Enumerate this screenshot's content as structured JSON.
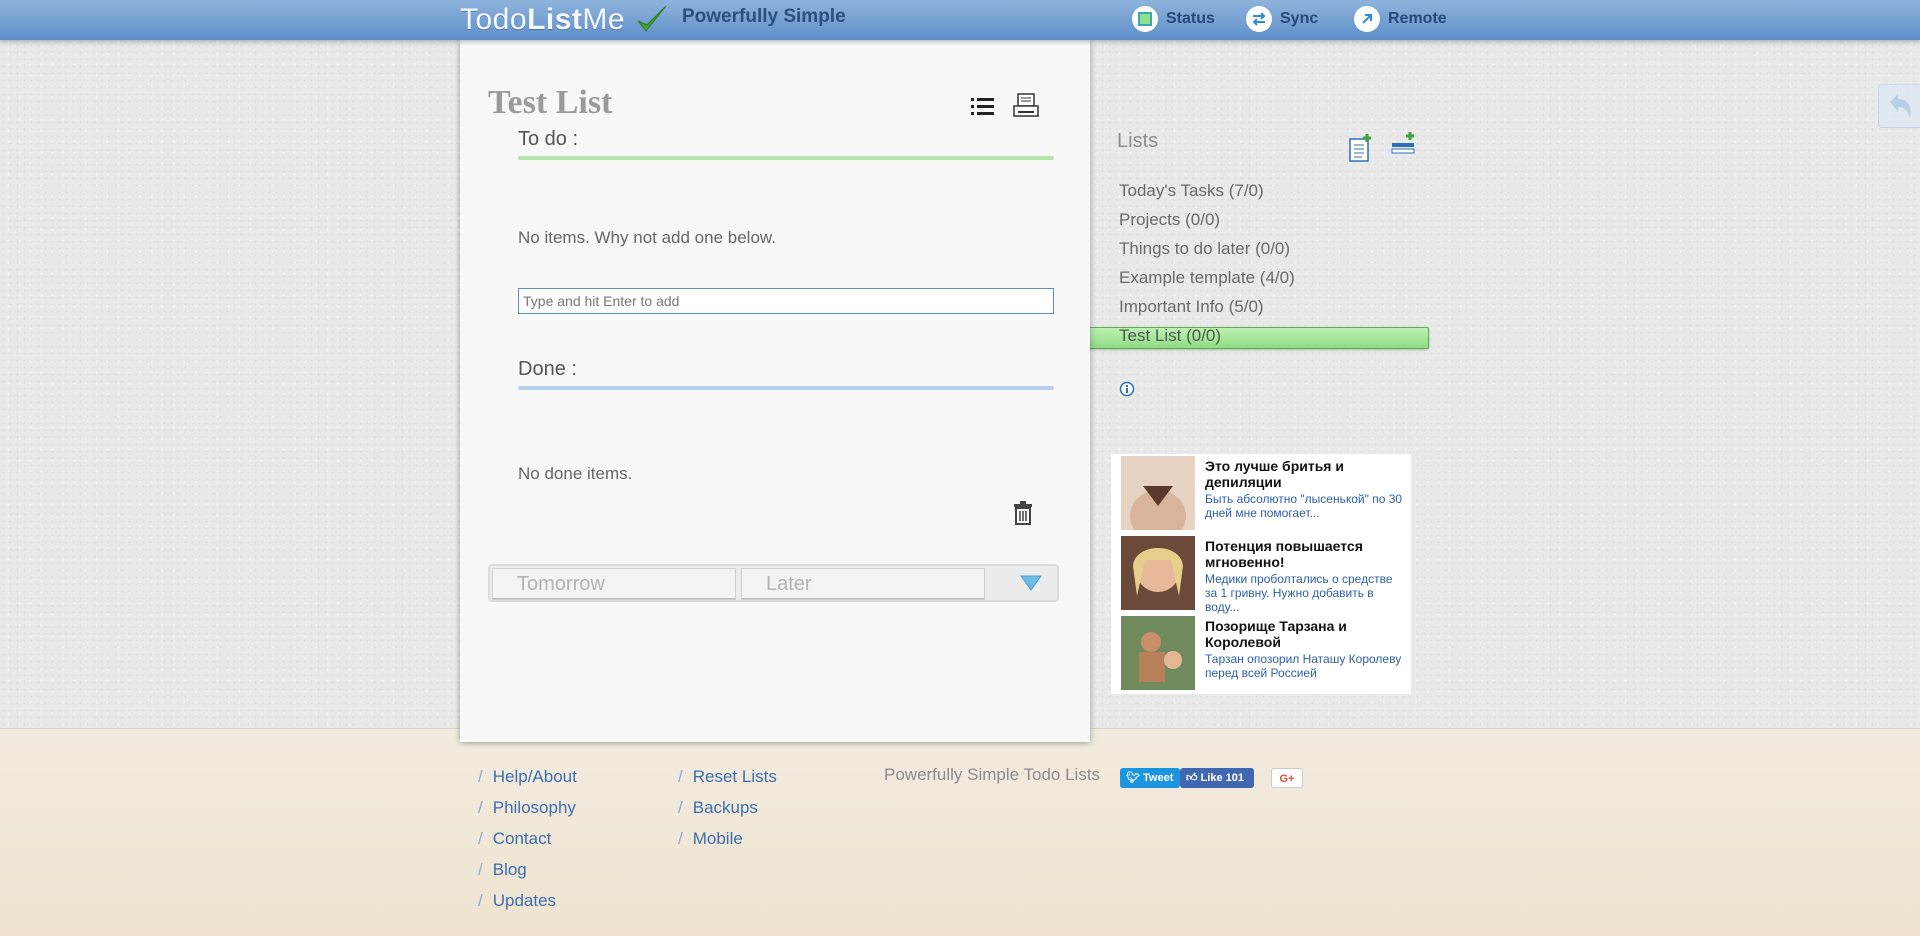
{
  "header": {
    "logo_part1": "Todo",
    "logo_part2": "List",
    "logo_part3": "Me",
    "tagline": "Powerfully Simple",
    "nav": [
      {
        "label": "Status",
        "icon": "status-icon"
      },
      {
        "label": "Sync",
        "icon": "sync-icon"
      },
      {
        "label": "Remote",
        "icon": "remote-icon"
      }
    ]
  },
  "list": {
    "title": "Test List",
    "todo_heading": "To do :",
    "todo_empty": "No items. Why not add one below.",
    "input_placeholder": "Type and hit Enter to add",
    "done_heading": "Done :",
    "done_empty": "No done items.",
    "tabs": [
      "Tomorrow",
      "Later"
    ]
  },
  "sidebar": {
    "title": "Lists",
    "items": [
      {
        "label": "Today's Tasks (7/0)"
      },
      {
        "label": "Projects (0/0)"
      },
      {
        "label": "Things to do later (0/0)"
      },
      {
        "label": "Example template (4/0)"
      },
      {
        "label": "Important Info (5/0)"
      },
      {
        "label": "Test List (0/0)",
        "active": true
      }
    ]
  },
  "ads": [
    {
      "title": "Это лучше бритья и депиляции",
      "desc": "Быть абсолютно \"лысенькой\" по 30 дней мне помогает..."
    },
    {
      "title": "Потенция повышается мгновенно!",
      "desc": "Медики проболтались о средстве за 1 гривну. Нужно добавить в воду..."
    },
    {
      "title": "Позорище Тарзана и Королевой",
      "desc": "Тарзан опозорил Наташу Королеву перед всей Россией"
    }
  ],
  "footer": {
    "col1": [
      "Help/About",
      "Philosophy",
      "Contact",
      "Blog",
      "Updates"
    ],
    "col2": [
      "Reset Lists",
      "Backups",
      "Mobile"
    ],
    "tagline": "Powerfully Simple Todo Lists",
    "social": {
      "tweet": "Tweet",
      "like": "Like 101",
      "gplus": "G+"
    }
  },
  "colors": {
    "header": "#5e8fc9",
    "todo_rule": "#b6e3a8",
    "done_rule": "#b6d0ea",
    "active_list": "#a6e69a",
    "link": "#3d6fb0"
  }
}
